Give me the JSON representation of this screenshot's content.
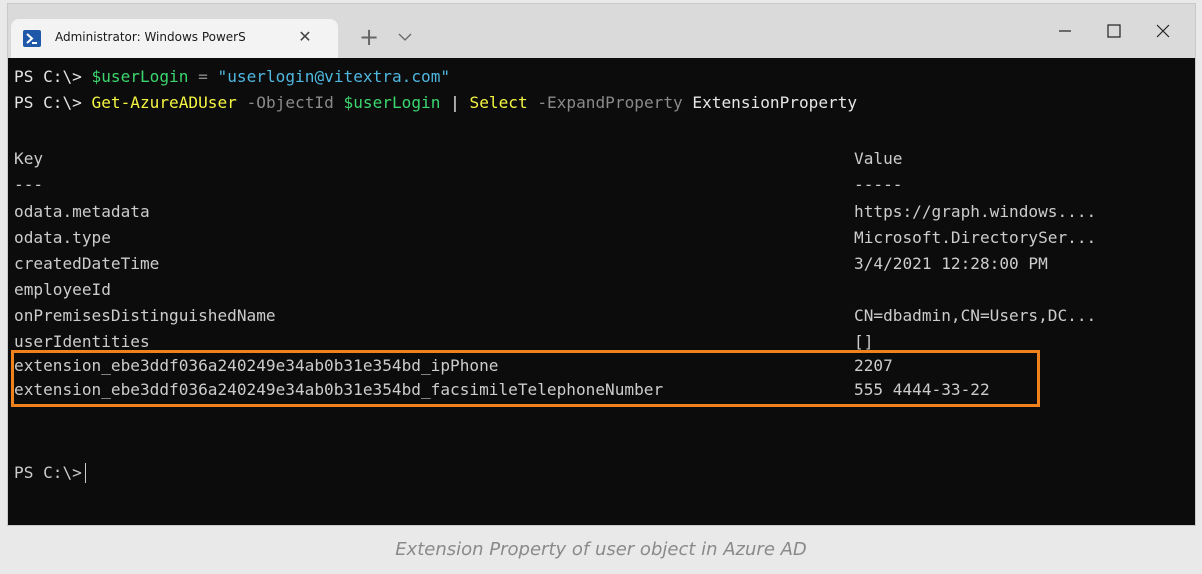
{
  "window": {
    "tab_title": "Administrator: Windows PowerS",
    "new_tab_label": "+",
    "tab_close_glyph": "✕"
  },
  "terminal": {
    "prompt": "PS C:\\>",
    "line1": {
      "variable": "$userLogin",
      "operator": "=",
      "string": "\"userlogin@vitextra.com\""
    },
    "line2": {
      "cmdlet": "Get-AzureADUser",
      "param1": "-ObjectId",
      "variable": "$userLogin",
      "pipe": "|",
      "select": "Select",
      "param2": "-ExpandProperty",
      "arg": "ExtensionProperty"
    },
    "headers": {
      "key": "Key",
      "value": "Value",
      "key_underline": "---",
      "value_underline": "-----"
    },
    "rows": [
      {
        "key": "odata.metadata",
        "value": "https://graph.windows...."
      },
      {
        "key": "odata.type",
        "value": "Microsoft.DirectorySer..."
      },
      {
        "key": "createdDateTime",
        "value": "3/4/2021 12:28:00 PM"
      },
      {
        "key": "employeeId",
        "value": ""
      },
      {
        "key": "onPremisesDistinguishedName",
        "value": "CN=dbadmin,CN=Users,DC..."
      },
      {
        "key": "userIdentities",
        "value": "[]"
      },
      {
        "key": "extension_ebe3ddf036a240249e34ab0b31e354bd_ipPhone",
        "value": "2207"
      },
      {
        "key": "extension_ebe3ddf036a240249e34ab0b31e354bd_facsimileTelephoneNumber",
        "value": "555 4444-33-22"
      }
    ]
  },
  "caption": "Extension Property of user object in Azure AD",
  "colors": {
    "highlight": "#f0821e",
    "terminal_bg": "#0c0c0c"
  }
}
